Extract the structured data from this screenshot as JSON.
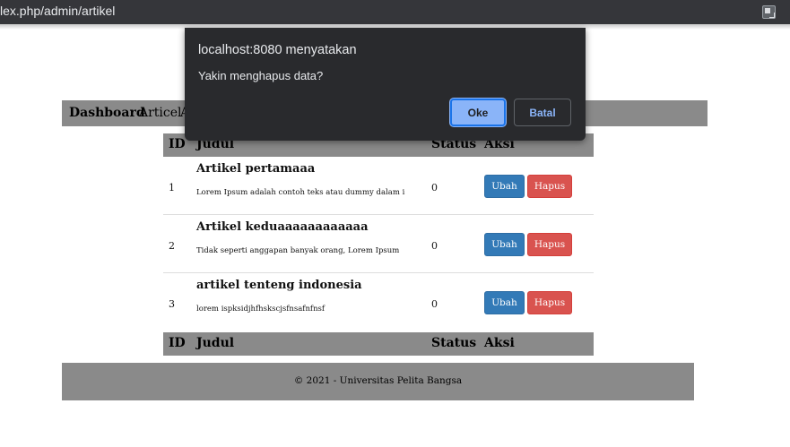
{
  "browser": {
    "url": "lex.php/admin/artikel",
    "translate_icon": "translate-icon"
  },
  "nav": {
    "home": "Dashboard",
    "article": "Articel",
    "about": "A"
  },
  "table": {
    "headers": {
      "id": "ID",
      "title": "Judul",
      "status": "Status",
      "actions": "Aksi"
    },
    "rows": [
      {
        "id": "1",
        "title": "Artikel pertamaaa",
        "desc": "Lorem Ipsum adalah contoh teks atau dummy dalam i",
        "status": "0",
        "edit": "Ubah",
        "delete": "Hapus"
      },
      {
        "id": "2",
        "title": "Artikel keduaaaaaaaaaaaa",
        "desc": "Tidak seperti anggapan banyak orang, Lorem Ipsum",
        "status": "0",
        "edit": "Ubah",
        "delete": "Hapus"
      },
      {
        "id": "3",
        "title": "artikel tenteng indonesia",
        "desc": "lorem ispksidjhfhskscjsfnsafnfnsf",
        "status": "0",
        "edit": "Ubah",
        "delete": "Hapus"
      }
    ]
  },
  "footer": {
    "text": "© 2021 - Universitas Pelita Bangsa"
  },
  "dialog": {
    "title": "localhost:8080 menyatakan",
    "message": "Yakin menghapus data?",
    "ok": "Oke",
    "cancel": "Batal"
  },
  "colors": {
    "nav_bg": "#8a8a8a",
    "edit_button": "#337ab7",
    "delete_button": "#d9534f",
    "dialog_bg": "#292a2d",
    "dialog_accent": "#8ab4f8"
  }
}
